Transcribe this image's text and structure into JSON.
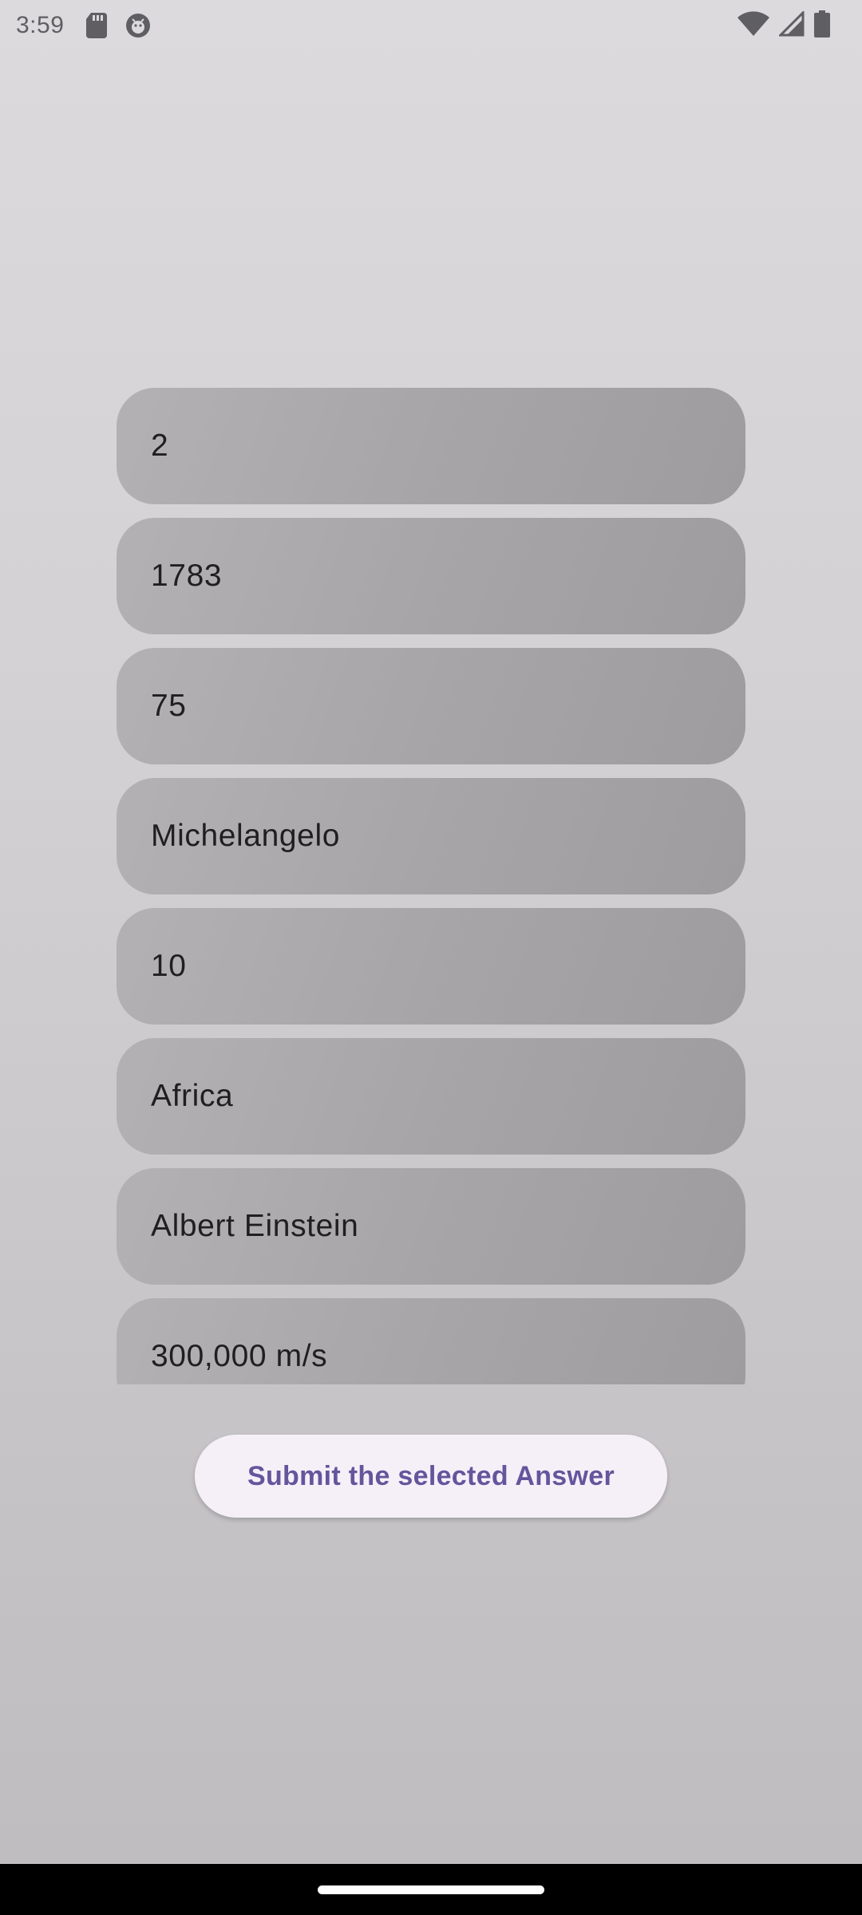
{
  "status_bar": {
    "time": "3:59",
    "icons_left": [
      "sd-card-icon",
      "debug-icon"
    ],
    "icons_right": [
      "wifi-icon",
      "cellular-signal-icon",
      "battery-icon"
    ]
  },
  "answers": [
    {
      "label": "2"
    },
    {
      "label": "1783"
    },
    {
      "label": "75"
    },
    {
      "label": "Michelangelo"
    },
    {
      "label": "10"
    },
    {
      "label": "Africa"
    },
    {
      "label": "Albert Einstein"
    },
    {
      "label": "300,000 m/s"
    }
  ],
  "submit": {
    "label": "Submit the selected Answer"
  },
  "colors": {
    "accent": "#65559c",
    "button_bg": "#f5f0f8",
    "answer_bg": "#a7a5a7"
  }
}
